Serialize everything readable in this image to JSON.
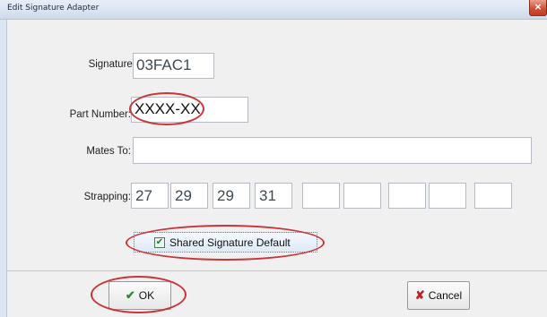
{
  "window": {
    "title": "Edit Signature Adapter",
    "close_glyph": "×"
  },
  "form": {
    "signature_label": "Signature:",
    "signature_value": "03FAC1",
    "part_number_label": "Part Number:",
    "part_number_value": "XXXX-XX",
    "mates_to_label": "Mates To:",
    "mates_to_value": "",
    "strapping_label": "Strapping:",
    "strapping_values": [
      "27",
      "29",
      "29",
      "31",
      "",
      "",
      "",
      "",
      ""
    ]
  },
  "shared_default": {
    "label": "Shared Signature Default",
    "checked": true,
    "check_glyph": "✔"
  },
  "buttons": {
    "ok_label": "OK",
    "ok_icon": "checkmark-icon",
    "ok_glyph": "✔",
    "cancel_label": "Cancel",
    "cancel_icon": "x-icon",
    "cancel_glyph": "✘"
  },
  "annotations": {
    "highlight_color": "#c9353a"
  }
}
